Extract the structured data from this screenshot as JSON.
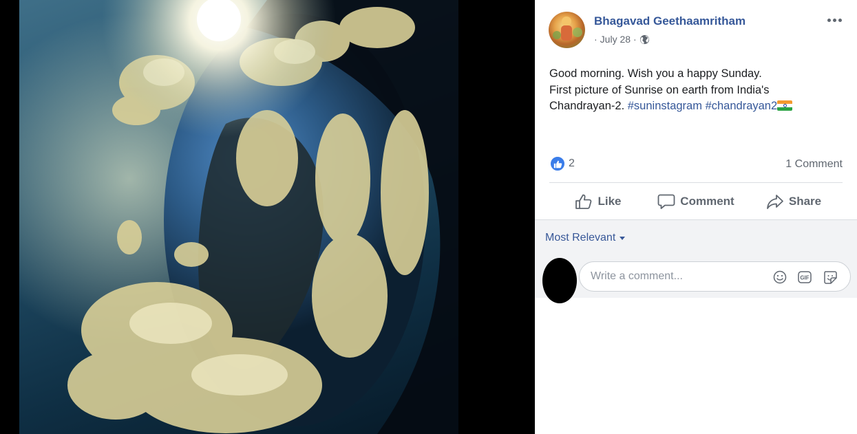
{
  "post": {
    "author": "Bhagavad Geethaamritham",
    "date": "July 28",
    "separator": "·",
    "audience_icon": "globe-icon",
    "text_line1": "Good morning. Wish you a happy Sunday.",
    "text_line2": "First picture of Sunrise on earth from India's",
    "text_line3_prefix": "Chandrayan-2. ",
    "hashtag1": "#suninstagram",
    "hashtag2": "#chandrayan2",
    "flag": "india-flag-emoji"
  },
  "engagement": {
    "reaction_icon": "like-reaction-icon",
    "reaction_count": "2",
    "comment_count": "1 Comment"
  },
  "actions": {
    "like": "Like",
    "comment": "Comment",
    "share": "Share"
  },
  "comments": {
    "sort_label": "Most Relevant",
    "placeholder": "Write a comment..."
  },
  "colors": {
    "link": "#365899",
    "meta_text": "#606770",
    "like_blue": "#3b7de9",
    "comments_bg": "#f2f3f5"
  }
}
